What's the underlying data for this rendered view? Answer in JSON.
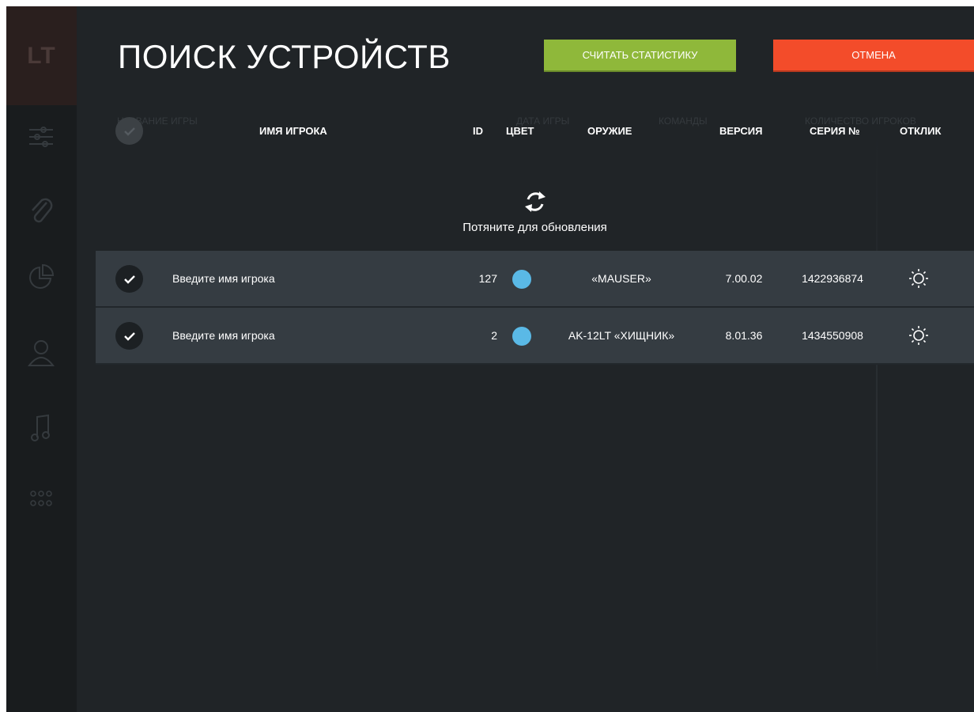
{
  "background": {
    "logo": "LT",
    "nav_icons": [
      "sliders-icon",
      "paperclip-icon",
      "pie-chart-icon",
      "user-icon",
      "music-icon",
      "apps-grid-icon"
    ],
    "headers": [
      "НАЗВАНИЕ ИГРЫ",
      "ДАТА ИГРЫ",
      "КОМАНДЫ",
      "КОЛИЧЕСТВО ИГРОКОВ"
    ]
  },
  "dialog": {
    "title": "ПОИСК УСТРОЙСТВ",
    "read_stats_label": "СЧИТАТЬ СТАТИСТИКУ",
    "cancel_label": "ОТМЕНА",
    "columns": {
      "name": "ИМЯ ИГРОКА",
      "id": "ID",
      "color": "ЦВЕТ",
      "weapon": "ОРУЖИЕ",
      "version": "ВЕРСИЯ",
      "serial": "СЕРИЯ №",
      "response": "ОТКЛИК"
    },
    "refresh_label": "Потяните для обновления",
    "rows": [
      {
        "selected": true,
        "name_placeholder": "Введите имя игрока",
        "id": "127",
        "color": "#5ab9e6",
        "weapon": "«MAUSER»",
        "version": "7.00.02",
        "serial": "1422936874"
      },
      {
        "selected": true,
        "name_placeholder": "Введите имя игрока",
        "id": "2",
        "color": "#5ab9e6",
        "weapon": "AK-12LT «ХИЩНИК»",
        "version": "8.01.36",
        "serial": "1434550908"
      }
    ]
  },
  "colors": {
    "accent_green": "#8fb83a",
    "accent_red": "#f34c2a",
    "row_bg": "#353c42",
    "page_bg": "#202427"
  }
}
